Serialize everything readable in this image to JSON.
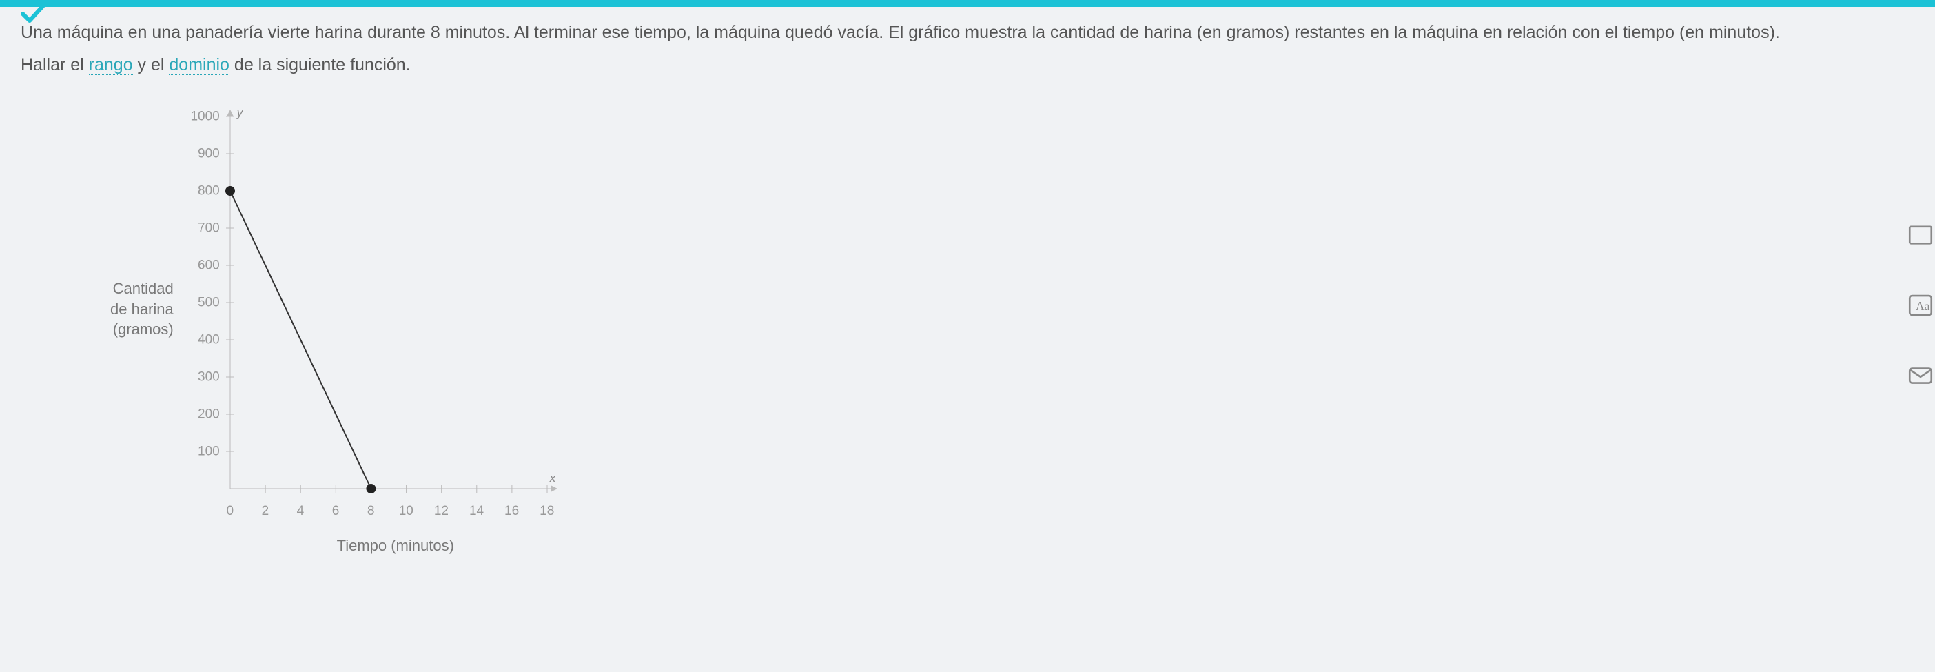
{
  "problem": {
    "p1": "Una máquina en una panadería vierte harina durante 8 minutos. Al terminar ese tiempo, la máquina quedó vacía. El gráfico muestra la cantidad de harina (en gramos) restantes en la máquina en relación con el tiempo (en minutos).",
    "p2a": "Hallar el ",
    "link_rango": "rango",
    "p2b": " y el ",
    "link_dominio": "dominio",
    "p2c": " de la siguiente función."
  },
  "chart_data": {
    "type": "line",
    "title": "",
    "xlabel": "Tiempo (minutos)",
    "ylabel_line1": "Cantidad",
    "ylabel_line2": "de harina",
    "ylabel_line3": "(gramos)",
    "y_ticks": [
      100,
      200,
      300,
      400,
      500,
      600,
      700,
      800,
      900,
      1000
    ],
    "x_ticks": [
      0,
      2,
      4,
      6,
      8,
      10,
      12,
      14,
      16,
      18
    ],
    "ylim": [
      0,
      1000
    ],
    "xlim": [
      0,
      18
    ],
    "x_var": "x",
    "y_var": "y",
    "series": [
      {
        "name": "harina",
        "points": [
          {
            "x": 0,
            "y": 800,
            "visible_endpoint": true
          },
          {
            "x": 8,
            "y": 0,
            "visible_endpoint": true
          }
        ]
      }
    ]
  }
}
